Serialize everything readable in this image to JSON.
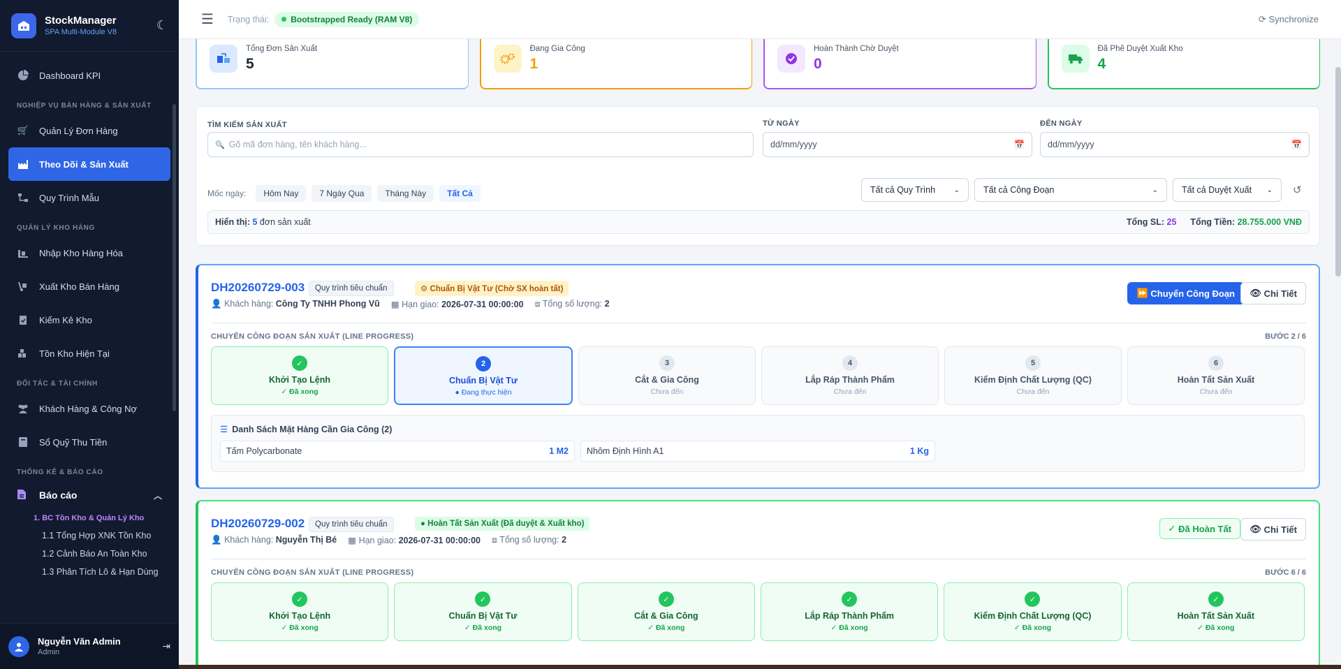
{
  "brand": {
    "name": "StockManager",
    "sub": "SPA Multi-Module V8"
  },
  "nav": {
    "dashboard": "Dashboard KPI",
    "section_sales": "NGHIỆP VỤ BÁN HÀNG & SẢN XUẤT",
    "orders": "Quản Lý Đơn Hàng",
    "production": "Theo Dõi & Sản Xuất",
    "templates": "Quy Trình Mẫu",
    "section_warehouse": "QUẢN LÝ KHO HÀNG",
    "import": "Nhập Kho Hàng Hóa",
    "export": "Xuất Kho Bán Hàng",
    "stocktake": "Kiểm Kê Kho",
    "inventory": "Tồn Kho Hiện Tại",
    "section_finance": "ĐỐI TÁC & TÀI CHÍNH",
    "customers": "Khách Hàng & Công Nợ",
    "cashbook": "Sổ Quỹ Thu Tiền",
    "section_reports": "THỐNG KÊ & BÁO CÁO",
    "reports": "Báo cáo",
    "report_sub_head": "1. BC Tồn Kho & Quản Lý Kho",
    "report_1": "1.1 Tổng Hợp XNK Tồn Kho",
    "report_2": "1.2 Cảnh Báo An Toàn Kho",
    "report_3": "1.3 Phân Tích Lô & Hạn Dùng"
  },
  "user": {
    "name": "Nguyễn Văn Admin",
    "role": "Admin"
  },
  "topbar": {
    "status_label": "Trạng thái:",
    "status": "Bootstrapped Ready (RAM V8)",
    "sync": "Synchronize"
  },
  "kpis": [
    {
      "label": "Tổng Đơn Sản Xuất",
      "value": "5",
      "color": "#2563eb"
    },
    {
      "label": "Đang Gia Công",
      "value": "1",
      "color": "#f59e0b"
    },
    {
      "label": "Hoàn Thành Chờ Duyệt",
      "value": "0",
      "color": "#9333ea"
    },
    {
      "label": "Đã Phê Duyệt Xuất Kho",
      "value": "4",
      "color": "#16a34a"
    }
  ],
  "filters": {
    "search_label": "TÌM KIẾM SẢN XUẤT",
    "search_placeholder": "Gõ mã đơn hàng, tên khách hàng...",
    "from_label": "TỪ NGÀY",
    "to_label": "ĐẾN NGÀY",
    "date_placeholder": "dd/mm/yyyy",
    "quick_label": "Mốc ngày:",
    "quick": [
      "Hôm Nay",
      "7 Ngày Qua",
      "Tháng Này",
      "Tất Cả"
    ],
    "select_process": "Tất cả Quy Trình",
    "select_stage": "Tất cả Công Đoạn",
    "select_approval": "Tất cả Duyệt Xuất",
    "showing_prefix": "Hiển thị:",
    "showing_count": "5",
    "showing_suffix": "đơn sản xuất",
    "total_qty_label": "Tổng SL:",
    "total_qty": "25",
    "total_money_label": "Tổng Tiền:",
    "total_money": "28.755.000 VNĐ"
  },
  "orders": [
    {
      "code": "DH20260729-003",
      "process": "Quy trình tiêu chuẩn",
      "status": "Chuẩn Bị Vật Tư (Chờ SX hoàn tất)",
      "customer_label": "Khách hàng:",
      "customer": "Công Ty TNHH Phong Vũ",
      "due_label": "Hạn giao:",
      "due": "2026-07-31 00:00:00",
      "qty_label": "Tổng số lượng:",
      "qty": "2",
      "action": "Chuyển Công Đoạn",
      "detail": "Chi Tiết",
      "progress_label": "CHUYỂN CÔNG ĐOẠN SẢN XUẤT (LINE PROGRESS)",
      "step_text": "BƯỚC 2 / 6",
      "steps": [
        {
          "num": "✓",
          "name": "Khởi Tạo Lệnh",
          "status": "✓ Đã xong"
        },
        {
          "num": "2",
          "name": "Chuẩn Bị Vật Tư",
          "status": "● Đang thực hiện"
        },
        {
          "num": "3",
          "name": "Cắt & Gia Công",
          "status": "Chưa đến"
        },
        {
          "num": "4",
          "name": "Lắp Ráp Thành Phẩm",
          "status": "Chưa đến"
        },
        {
          "num": "5",
          "name": "Kiểm Định Chất Lượng (QC)",
          "status": "Chưa đến"
        },
        {
          "num": "6",
          "name": "Hoàn Tất Sản Xuất",
          "status": "Chưa đến"
        }
      ],
      "items_title": "Danh Sách Mặt Hàng Cần Gia Công (2)",
      "items": [
        {
          "name": "Tấm Polycarbonate",
          "qty": "1 M2"
        },
        {
          "name": "Nhôm Định Hình A1",
          "qty": "1 Kg"
        }
      ]
    },
    {
      "code": "DH20260729-002",
      "process": "Quy trình tiêu chuẩn",
      "status": "Hoàn Tất Sản Xuất (Đã duyệt & Xuất kho)",
      "customer_label": "Khách hàng:",
      "customer": "Nguyễn Thị Bé",
      "due_label": "Hạn giao:",
      "due": "2026-07-31 00:00:00",
      "qty_label": "Tổng số lượng:",
      "qty": "2",
      "action": "Đã Hoàn Tất",
      "detail": "Chi Tiết",
      "progress_label": "CHUYỂN CÔNG ĐOẠN SẢN XUẤT (LINE PROGRESS)",
      "step_text": "BƯỚC 6 / 6",
      "steps": [
        {
          "num": "✓",
          "name": "Khởi Tạo Lệnh",
          "status": "✓ Đã xong"
        },
        {
          "num": "✓",
          "name": "Chuẩn Bị Vật Tư",
          "status": "✓ Đã xong"
        },
        {
          "num": "✓",
          "name": "Cắt & Gia Công",
          "status": "✓ Đã xong"
        },
        {
          "num": "✓",
          "name": "Lắp Ráp Thành Phẩm",
          "status": "✓ Đã xong"
        },
        {
          "num": "✓",
          "name": "Kiểm Định Chất Lượng (QC)",
          "status": "✓ Đã xong"
        },
        {
          "num": "✓",
          "name": "Hoàn Tất Sản Xuất",
          "status": "✓ Đã xong"
        }
      ]
    }
  ]
}
